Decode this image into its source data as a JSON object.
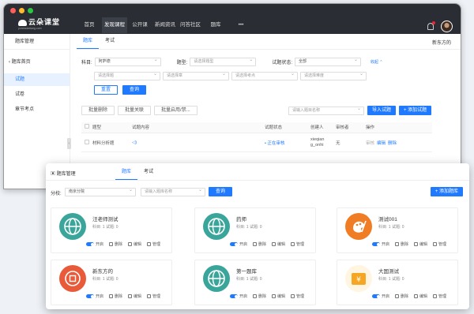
{
  "top": {
    "logo_text": "云朵课堂",
    "logo_sub": "yunduoketang.com",
    "nav": [
      "首页",
      "发现课程",
      "公开课",
      "新闻资讯",
      "问答社区",
      "题库",
      "•••"
    ],
    "nav_active": 1
  },
  "sidebar": {
    "title": "题库管理",
    "back": "题库首页",
    "items": [
      "试题",
      "试卷",
      "章节考点"
    ],
    "active": 0
  },
  "main": {
    "tabs": [
      "题库",
      "考试"
    ],
    "user_name": "新东方的",
    "filters": {
      "subject_label": "科目:",
      "subject_value": "阿萨德",
      "type_label": "题型:",
      "type_placeholder": "请选择题型",
      "status_label": "试题状态:",
      "status_value": "全部",
      "collapse": "收起",
      "row2": [
        "请选择题",
        "请选择章",
        "请选择考点",
        "请选择难度"
      ]
    },
    "btn_reset": "重置",
    "btn_query": "查询",
    "btn_batch_delete": "批量删除",
    "btn_batch_relate": "批量关联",
    "btn_batch_toggle": "批量启用/禁...",
    "search_placeholder": "请输入题目名称",
    "btn_import": "导入试题",
    "btn_add": "+ 添加试题",
    "columns": [
      "题型",
      "试题内容",
      "试题状态",
      "创建人",
      "审核者",
      "操作"
    ],
    "row": {
      "type": "材料分析题",
      "status": "• 正在审核",
      "creator_line1": "xieqian",
      "creator_line2": "g_onhi",
      "reviewer": "无",
      "ops": [
        "审核",
        "编辑",
        "删除"
      ]
    }
  },
  "front": {
    "title": "题库管理",
    "tabs": [
      "题库",
      "考试"
    ],
    "branch_label": "分校:",
    "branch_value": "南京分院",
    "search_placeholder": "请输入题库名称",
    "btn_query": "查询",
    "btn_add": "+ 添加题库",
    "actions": [
      "开启",
      "删除",
      "编辑",
      "管理"
    ],
    "cards": [
      {
        "name": "汪老师测试",
        "meta": "科目: 1   试题: 0",
        "icon": "globe-icon",
        "color": "#3aa59a"
      },
      {
        "name": "药师",
        "meta": "科目: 1   试题: 0",
        "icon": "globe-icon",
        "color": "#3aa59a"
      },
      {
        "name": "测试001",
        "meta": "科目: 1   试题: 0",
        "icon": "palette-icon",
        "color": "#f07c24"
      },
      {
        "name": "新东方的",
        "meta": "科目: 1   试题: 0",
        "icon": "coin-icon",
        "color": "#e95a3a"
      },
      {
        "name": "第一题库",
        "meta": "科目: 1   试题: 0",
        "icon": "globe-icon",
        "color": "#3aa59a"
      },
      {
        "name": "大国测试",
        "meta": "科目: 1   试题: 0",
        "icon": "money-icon",
        "color": "#f5a623"
      }
    ]
  }
}
